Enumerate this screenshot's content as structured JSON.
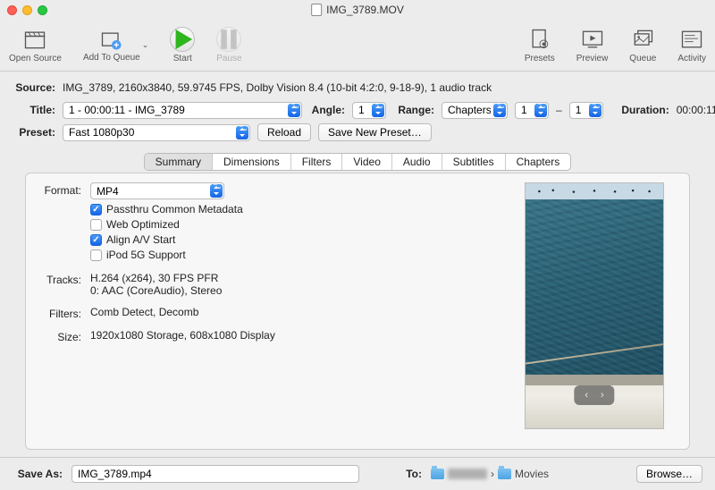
{
  "window": {
    "title": "IMG_3789.MOV"
  },
  "toolbar": {
    "open_source": "Open Source",
    "add_queue": "Add To Queue",
    "start": "Start",
    "pause": "Pause",
    "presets": "Presets",
    "preview": "Preview",
    "queue": "Queue",
    "activity": "Activity"
  },
  "info": {
    "source_label": "Source:",
    "source_value": "IMG_3789, 2160x3840, 59.9745 FPS, Dolby Vision 8.4 (10-bit 4:2:0, 9-18-9), 1 audio track",
    "title_label": "Title:",
    "title_value": "1 - 00:00:11 - IMG_3789",
    "angle_label": "Angle:",
    "angle_value": "1",
    "range_label": "Range:",
    "range_mode": "Chapters",
    "range_from": "1",
    "range_to": "1",
    "duration_label": "Duration:",
    "duration_value": "00:00:11",
    "preset_label": "Preset:",
    "preset_value": "Fast 1080p30",
    "reload": "Reload",
    "save_preset": "Save New Preset…"
  },
  "tabs": {
    "summary": "Summary",
    "dimensions": "Dimensions",
    "filters": "Filters",
    "video": "Video",
    "audio": "Audio",
    "subtitles": "Subtitles",
    "chapters": "Chapters"
  },
  "summary": {
    "format_label": "Format:",
    "format_value": "MP4",
    "chk_passthru": "Passthru Common Metadata",
    "chk_web": "Web Optimized",
    "chk_align": "Align A/V Start",
    "chk_ipod": "iPod 5G Support",
    "tracks_label": "Tracks:",
    "tracks_line1": "H.264 (x264), 30 FPS PFR",
    "tracks_line2": "0: AAC (CoreAudio), Stereo",
    "filters_label": "Filters:",
    "filters_value": "Comb Detect, Decomb",
    "size_label": "Size:",
    "size_value": "1920x1080 Storage, 608x1080 Display"
  },
  "bottom": {
    "saveas_label": "Save As:",
    "saveas_value": "IMG_3789.mp4",
    "to_label": "To:",
    "folder": "Movies",
    "browse": "Browse…"
  }
}
